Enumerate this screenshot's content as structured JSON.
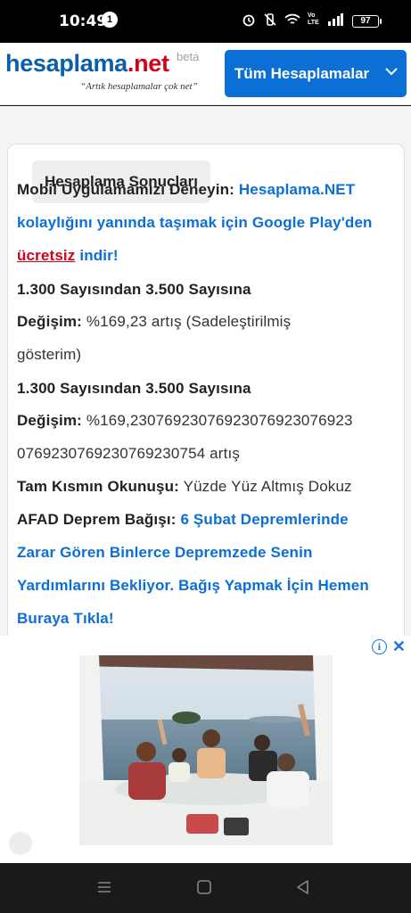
{
  "status_bar": {
    "time": "10:49",
    "notification_count": "1",
    "battery": "97",
    "network": "Vo LTE"
  },
  "header": {
    "logo_part1": "hesaplama",
    "logo_part2": ".net",
    "logo_beta": "beta",
    "logo_tagline": "“Artık hesaplamalar çok net”",
    "menu_button_label": "Tüm Hesaplamalar"
  },
  "results": {
    "title": "Hesaplama Sonuçları",
    "promo_prefix": "Mobil Uygulamamızı Deneyin:",
    "promo_link_1": "Hesaplama.NET",
    "promo_link_2": "kolaylığını yanında taşımak için Google Play'den",
    "promo_free": "ücretsiz",
    "promo_link_3": "indir!",
    "range_title_1": "1.300 Sayısından 3.500 Sayısına",
    "change_label_1": "Değişim:",
    "change_value_1": "%169,23 artış (Sadeleştirilmiş",
    "change_value_1_cont": "gösterim)",
    "range_title_2": "1.300 Sayısından 3.500 Sayısına",
    "change_label_2": "Değişim:",
    "change_value_2": "%169,2307692307692307692307692 3",
    "change_value_2_a": "%169,2307692307692307692307692 3",
    "change_value_2_line1": "%169,230769230769230769230769 23",
    "change_value_2_cont": "0769230769230769230754 artış",
    "reading_label": "Tam Kısmın Okunuşu:",
    "reading_value": "Yüzde Yüz Altmış Dokuz",
    "afad_label": "AFAD Deprem Bağışı:",
    "afad_link_1": "6 Şubat Depremlerinde",
    "afad_link_2": "Zarar Gören Binlerce Depremzede Senin",
    "afad_link_3": "Yardımlarını Bekliyor. Bağış Yapmak İçin Hemen",
    "afad_link_4": "Buraya Tıkla!"
  },
  "ad": {
    "info_icon": "info-icon",
    "close_icon": "close-icon"
  },
  "colors": {
    "brand_blue": "#0b5fa8",
    "link_blue": "#0b6fd6",
    "brand_red": "#d0021b"
  }
}
